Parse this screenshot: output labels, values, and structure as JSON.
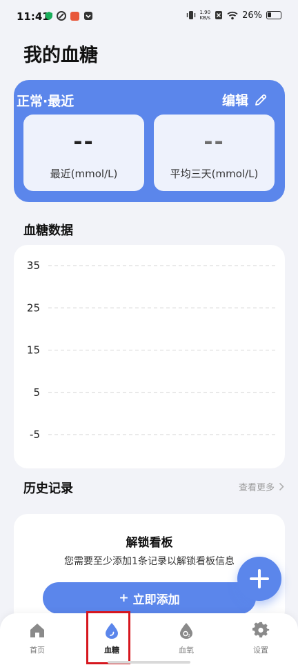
{
  "status_bar": {
    "time": "11:41",
    "net_speed_value": "1.90",
    "net_speed_unit": "KB/s",
    "battery": "26%"
  },
  "page": {
    "title": "我的血糖"
  },
  "recent_card": {
    "title": "正常·最近",
    "edit_label": "编辑",
    "latest": {
      "value": "--",
      "label": "最近(mmol/L)"
    },
    "avg3d": {
      "value": "--",
      "label": "平均三天(mmol/L)"
    },
    "accent_color": "#5B86EB"
  },
  "chart_section": {
    "title": "血糖数据"
  },
  "chart_data": {
    "type": "line",
    "title": "",
    "xlabel": "",
    "ylabel": "",
    "y_ticks": [
      35,
      25,
      15,
      5,
      -5
    ],
    "ylim": [
      -5,
      35
    ],
    "series": [],
    "grid": "dashed horizontal"
  },
  "history_section": {
    "title": "历史记录",
    "more_label": "查看更多"
  },
  "unlock_card": {
    "title": "解锁看板",
    "description": "您需要至少添加1条记录以解锁看板信息",
    "button_label": "立即添加",
    "button_prefix": "+"
  },
  "fab": {
    "icon": "plus-icon"
  },
  "bottom_nav": {
    "items": [
      {
        "label": "首页",
        "icon": "home-icon"
      },
      {
        "label": "血糖",
        "icon": "blood-drop-icon",
        "active": true
      },
      {
        "label": "血氧",
        "icon": "oxygen-drop-icon"
      },
      {
        "label": "设置",
        "icon": "gear-icon"
      }
    ]
  }
}
